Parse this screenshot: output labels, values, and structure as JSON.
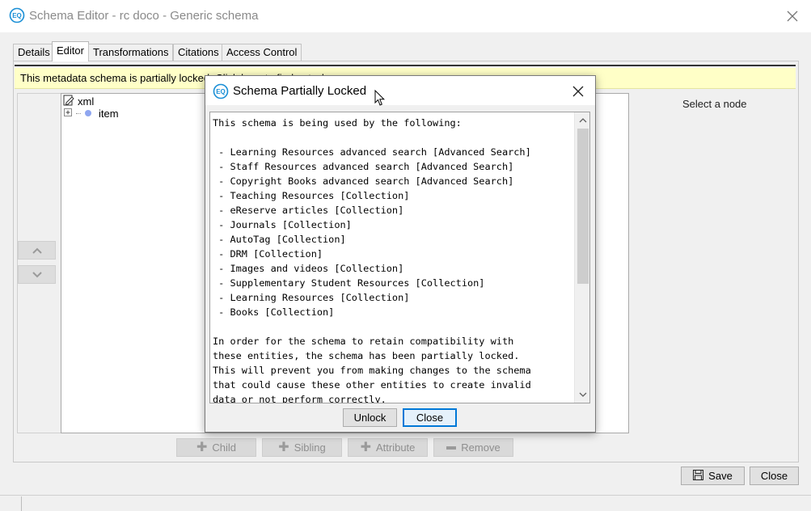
{
  "window": {
    "title": "Schema Editor - rc doco - Generic schema",
    "icon": "eq-logo-icon",
    "close_icon": "close-icon"
  },
  "tabs": [
    {
      "label": "Details",
      "active": false
    },
    {
      "label": "Editor",
      "active": true
    },
    {
      "label": "Transformations",
      "active": false
    },
    {
      "label": "Citations",
      "active": false
    },
    {
      "label": "Access Control",
      "active": false
    }
  ],
  "banner": {
    "text": "This metadata schema is partially locked. Click here to find out why."
  },
  "tree": {
    "nodes": [
      {
        "label": "xml",
        "icon": "edit-document-icon"
      },
      {
        "label": "item",
        "icon": "expand-plus-icon"
      }
    ],
    "move_up_icon": "chevron-up-icon",
    "move_down_icon": "chevron-down-icon"
  },
  "details_panel": {
    "placeholder": "Select a node"
  },
  "tree_actions": [
    {
      "label": "Child",
      "icon": "plus-icon"
    },
    {
      "label": "Sibling",
      "icon": "plus-icon"
    },
    {
      "label": "Attribute",
      "icon": "plus-icon"
    },
    {
      "label": "Remove",
      "icon": "minus-icon"
    }
  ],
  "footer": {
    "save_label": "Save",
    "close_label": "Close",
    "save_icon": "floppy-disk-icon"
  },
  "dialog": {
    "title": "Schema Partially Locked",
    "icon": "eq-logo-icon",
    "body": "This schema is being used by the following:\n\n - Learning Resources advanced search [Advanced Search]\n - Staff Resources advanced search [Advanced Search]\n - Copyright Books advanced search [Advanced Search]\n - Teaching Resources [Collection]\n - eReserve articles [Collection]\n - Journals [Collection]\n - AutoTag [Collection]\n - DRM [Collection]\n - Images and videos [Collection]\n - Supplementary Student Resources [Collection]\n - Learning Resources [Collection]\n - Books [Collection]\n\nIn order for the schema to retain compatibility with\nthese entities, the schema has been partially locked.\nThis will prevent you from making changes to the schema\nthat could cause these other entities to create invalid\ndata or not perform correctly.",
    "unlock_label": "Unlock",
    "close_label": "Close"
  },
  "colors": {
    "banner_bg": "#ffffc7",
    "focus_border": "#0078d7",
    "logo_blue": "#1a8fd6"
  }
}
